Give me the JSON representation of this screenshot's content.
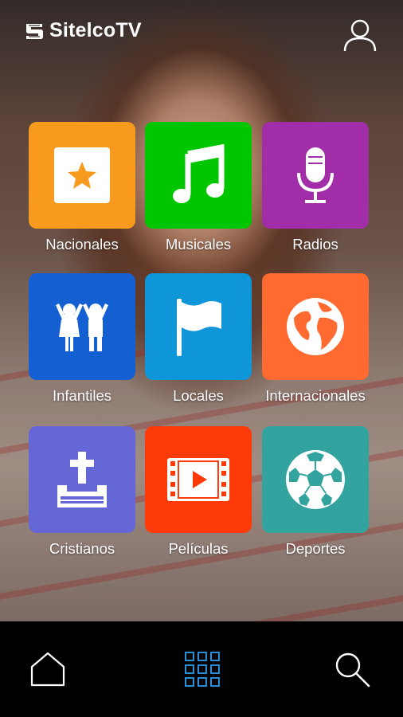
{
  "app": {
    "title": "SitelcoTV"
  },
  "header": {
    "user_icon": "user-icon"
  },
  "categories": [
    {
      "label": "Nacionales",
      "color": "#F79A1E",
      "icon": "star-icon"
    },
    {
      "label": "Musicales",
      "color": "#00C600",
      "icon": "music-note-icon"
    },
    {
      "label": "Radios",
      "color": "#A22DA8",
      "icon": "microphone-icon"
    },
    {
      "label": "Infantiles",
      "color": "#1460D2",
      "icon": "children-icon"
    },
    {
      "label": "Locales",
      "color": "#0E96D9",
      "icon": "flag-icon"
    },
    {
      "label": "Internacionales",
      "color": "#FE6A30",
      "icon": "globe-icon"
    },
    {
      "label": "Cristianos",
      "color": "#6667D6",
      "icon": "bible-cross-icon"
    },
    {
      "label": "Películas",
      "color": "#FE3A09",
      "icon": "film-icon"
    },
    {
      "label": "Deportes",
      "color": "#33A39F",
      "icon": "soccer-ball-icon"
    }
  ],
  "bottom_nav": {
    "items": [
      {
        "icon": "home-icon"
      },
      {
        "icon": "grid-icon",
        "active": true,
        "color": "#2B8FD6"
      },
      {
        "icon": "search-icon"
      }
    ]
  }
}
